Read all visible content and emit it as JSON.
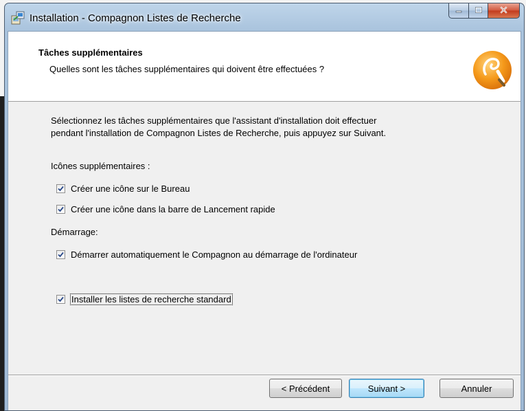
{
  "window": {
    "title": "Installation - Compagnon Listes de Recherche"
  },
  "header": {
    "title": "Tâches supplémentaires",
    "subtitle": "Quelles sont les tâches supplémentaires qui doivent être effectuées ?"
  },
  "content": {
    "intro_line1": "Sélectionnez les tâches supplémentaires que l'assistant d'installation doit effectuer",
    "intro_line2": "pendant l'installation de Compagnon Listes de Recherche, puis appuyez sur Suivant.",
    "group_icons_label": "Icônes supplémentaires :",
    "group_startup_label": "Démarrage:",
    "tasks": [
      {
        "label": "Créer une icône sur le Bureau",
        "checked": true
      },
      {
        "label": "Créer une icône dans la barre de Lancement rapide",
        "checked": true
      },
      {
        "label": "Démarrer automatiquement le Compagnon au démarrage de l'ordinateur",
        "checked": true
      },
      {
        "label": "Installer les listes de recherche standard",
        "checked": true
      }
    ]
  },
  "buttons": {
    "previous": "< Précédent",
    "next": "Suivant >",
    "cancel": "Annuler"
  },
  "icons": {
    "app": "setup-icon",
    "logo": "orange-search-logo",
    "minimize": "minimize-icon",
    "maximize": "maximize-icon",
    "close": "close-icon",
    "checkmark": "checkmark-icon"
  },
  "colors": {
    "close_button": "#c8452a",
    "logo_orange": "#f39a1e",
    "header_bg": "#ffffff",
    "dialog_bg": "#f0f0f0"
  }
}
